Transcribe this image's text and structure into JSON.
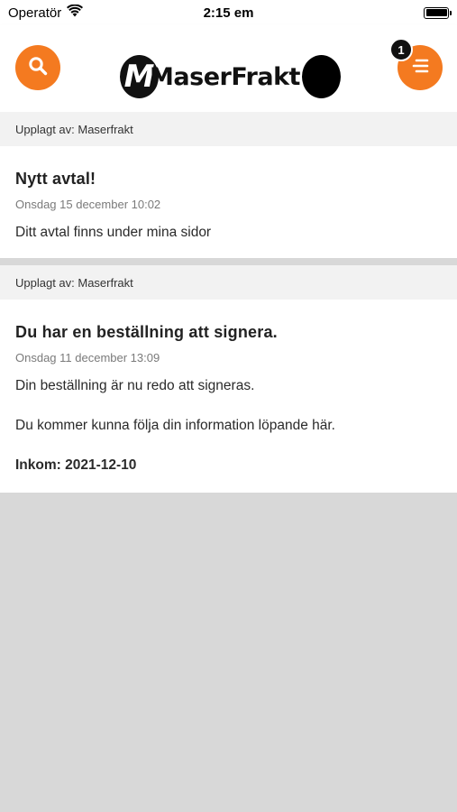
{
  "status_bar": {
    "carrier": "Operatör",
    "time": "2:15 em"
  },
  "header": {
    "logo_text": "MaserFrakt",
    "logo_letter": "M",
    "menu_badge": "1",
    "accent_color": "#f47a20"
  },
  "posts": [
    {
      "posted_by": "Upplagt av: Maserfrakt",
      "title": "Nytt avtal!",
      "date": "Onsdag 15 december 10:02",
      "lines": [
        "Ditt avtal finns under mina sidor"
      ]
    },
    {
      "posted_by": "Upplagt av: Maserfrakt",
      "title": "Du har en beställning att signera.",
      "date": "Onsdag 11 december 13:09",
      "lines": [
        "Din beställning är nu redo att signeras.",
        "Du kommer kunna följa din information löpande här.",
        "Inkom: 2021-12-10"
      ]
    }
  ]
}
